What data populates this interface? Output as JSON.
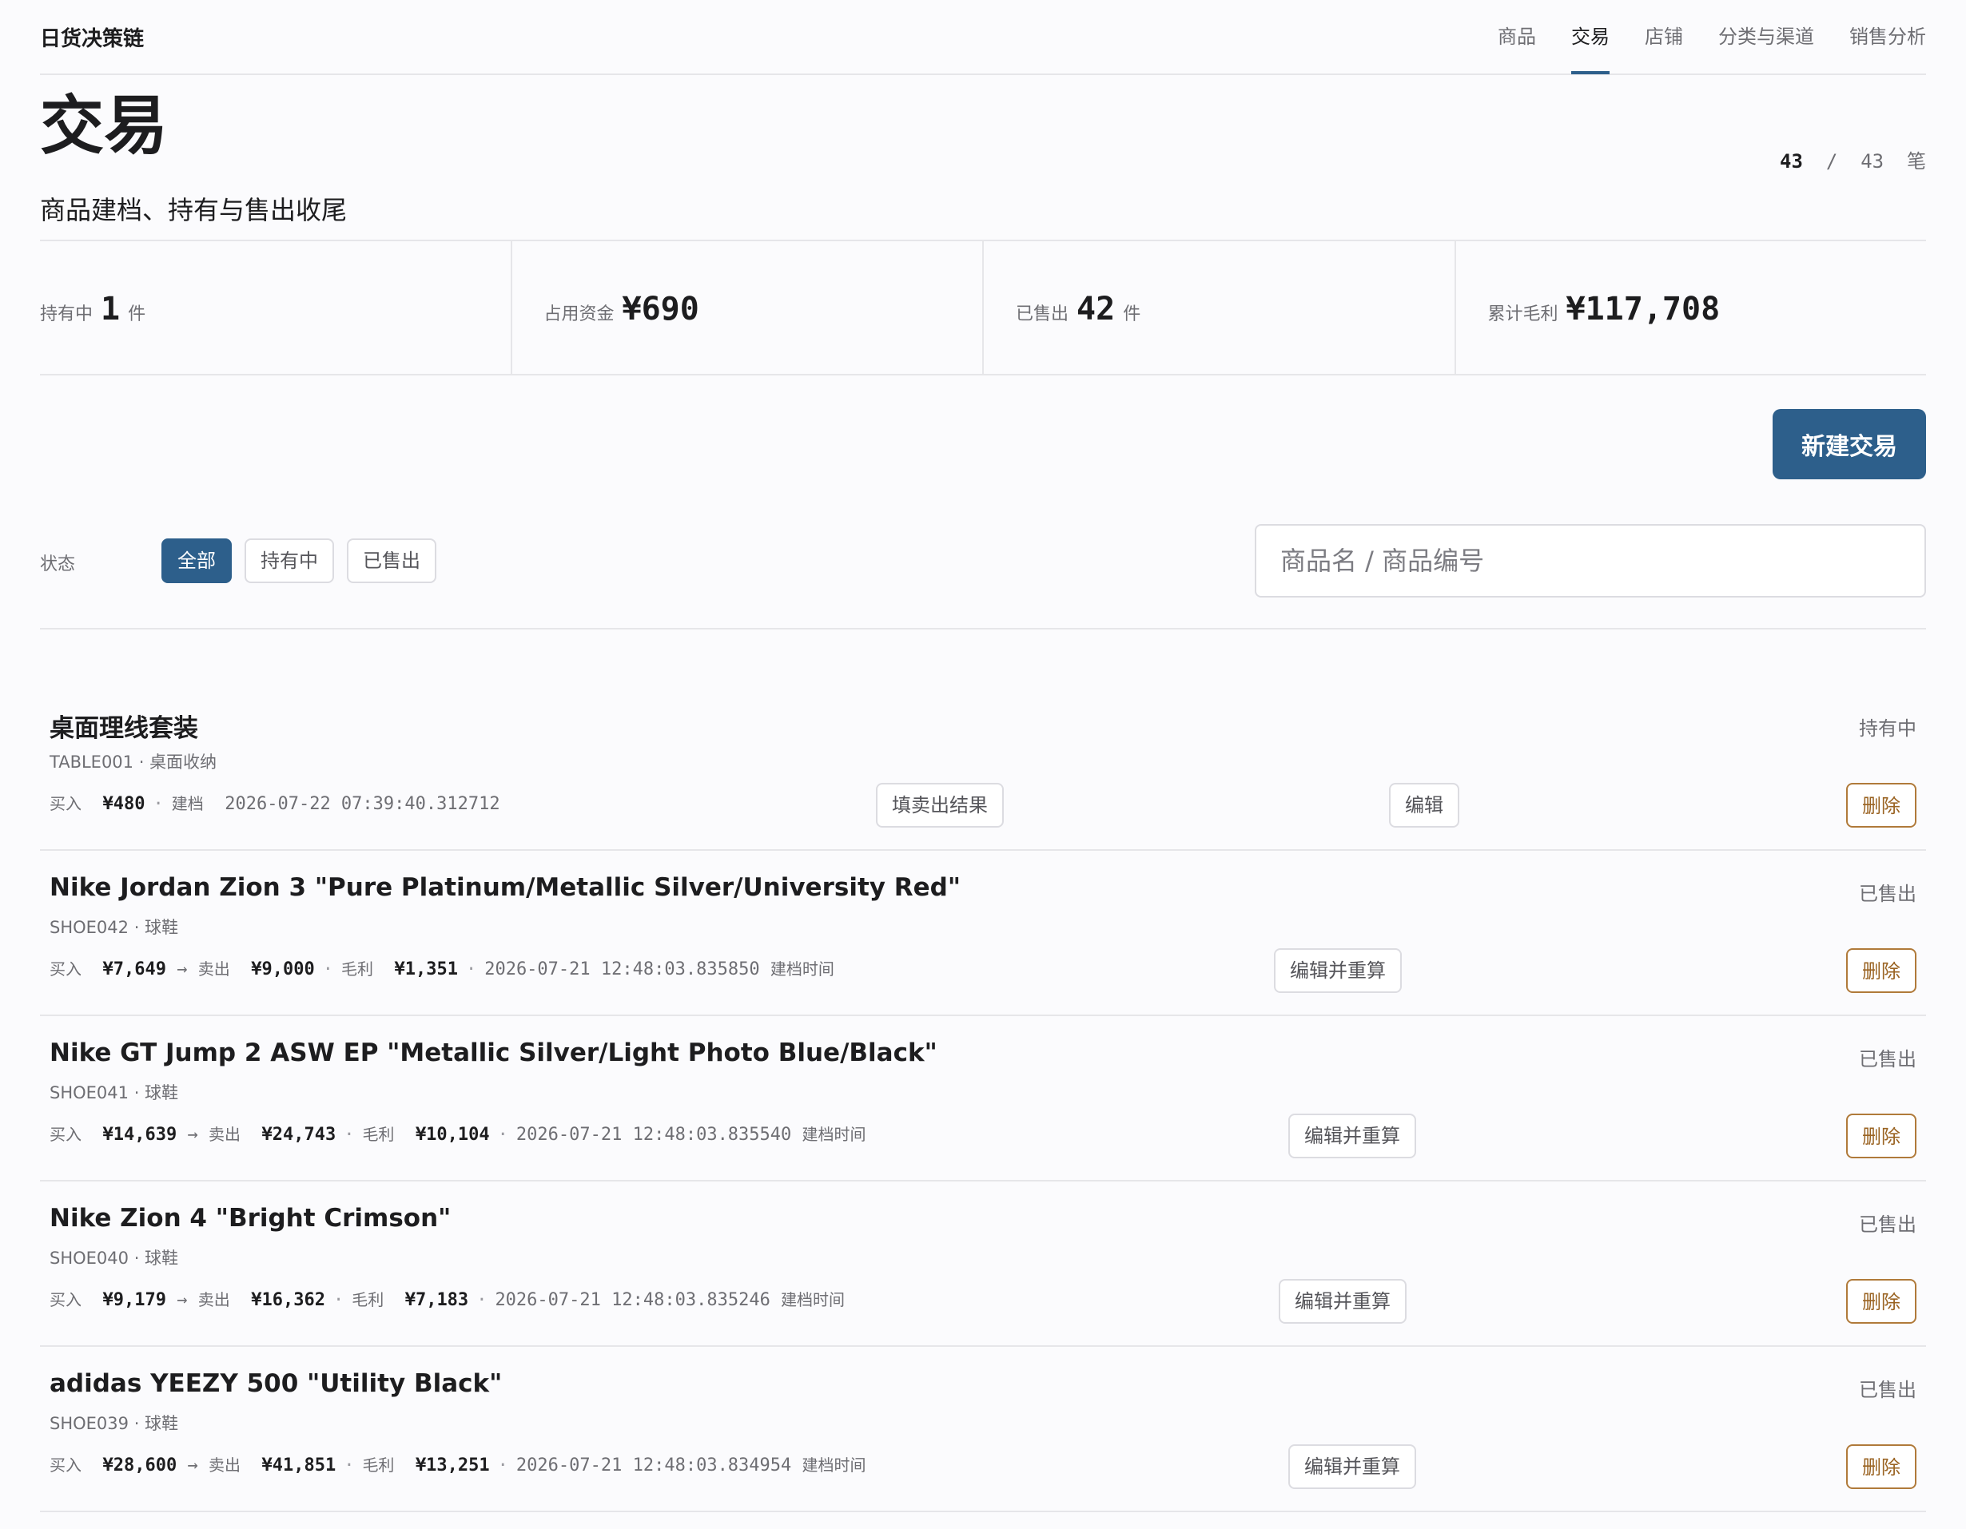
{
  "app": {
    "brand": "日货决策链"
  },
  "nav": [
    "商品",
    "交易",
    "店铺",
    "分类与渠道",
    "销售分析"
  ],
  "page": {
    "title": "交易",
    "subtitle": "商品建档、持有与售出收尾",
    "count_shown": "43",
    "count_sep": "/",
    "count_total": "43",
    "count_unit": "笔"
  },
  "stats": [
    {
      "label": "持有中",
      "value": "1",
      "unit": "件"
    },
    {
      "label": "占用资金",
      "value": "¥690",
      "unit": ""
    },
    {
      "label": "已售出",
      "value": "42",
      "unit": "件"
    },
    {
      "label": "累计毛利",
      "value": "¥117,708",
      "unit": ""
    }
  ],
  "new_button": "新建交易",
  "filter": {
    "label": "状态",
    "chips": [
      "全部",
      "持有中",
      "已售出"
    ],
    "selected": "全部",
    "search_placeholder": "商品名 / 商品编号"
  },
  "labels": {
    "buy": "买入",
    "sell": "卖出",
    "profit": "毛利",
    "filed": "建档",
    "filed_time": "建档时间",
    "arrow": "→",
    "dot": "·",
    "fill_result": "填卖出结果",
    "edit": "编辑",
    "edit_recalc": "编辑并重算",
    "delete": "删除"
  },
  "trades": [
    {
      "name": "桌面理线套装",
      "code": "TABLE001",
      "category": "桌面收纳",
      "status": "持有中",
      "buy": "¥480",
      "time": "2026-07-22 07:39:40.312712"
    },
    {
      "name": "Nike Jordan Zion 3 \"Pure Platinum/Metallic Silver/University Red\"",
      "code": "SHOE042",
      "category": "球鞋",
      "status": "已售出",
      "buy": "¥7,649",
      "sell": "¥9,000",
      "profit": "¥1,351",
      "time": "2026-07-21 12:48:03.835850"
    },
    {
      "name": "Nike GT Jump 2 ASW EP \"Metallic Silver/Light Photo Blue/Black\"",
      "code": "SHOE041",
      "category": "球鞋",
      "status": "已售出",
      "buy": "¥14,639",
      "sell": "¥24,743",
      "profit": "¥10,104",
      "time": "2026-07-21 12:48:03.835540"
    },
    {
      "name": "Nike Zion 4 \"Bright Crimson\"",
      "code": "SHOE040",
      "category": "球鞋",
      "status": "已售出",
      "buy": "¥9,179",
      "sell": "¥16,362",
      "profit": "¥7,183",
      "time": "2026-07-21 12:48:03.835246"
    },
    {
      "name": "adidas YEEZY 500 \"Utility Black\"",
      "code": "SHOE039",
      "category": "球鞋",
      "status": "已售出",
      "buy": "¥28,600",
      "sell": "¥41,851",
      "profit": "¥13,251",
      "time": "2026-07-21 12:48:03.834954"
    }
  ]
}
